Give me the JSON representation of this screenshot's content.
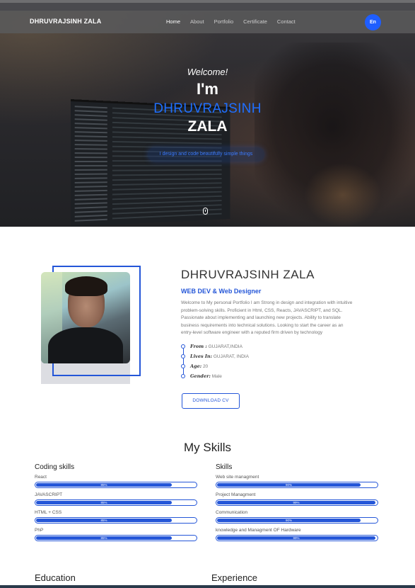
{
  "nav": {
    "brand": "DHRUVRAJSINH ZALA",
    "links": [
      "Home",
      "About",
      "Portfolio",
      "Certificate",
      "Contact"
    ],
    "active": "Home",
    "lang_button": "En"
  },
  "hero": {
    "welcome": "Welcome!",
    "im": "I'm",
    "first_name": "DHRUVRAJSINH",
    "last_name": "ZALA",
    "tagline": "I design and code beautifully simple things"
  },
  "about": {
    "name": "DHRUVRAJSINH ZALA",
    "role": "WEB DEV & Web Designer",
    "description": "Welcome to My personal Portfolio I am Strong in design and integration with intuitive problem-solving skills. Proficient in Html, CSS, Reacts, JAVASCRIPT, and SQL. Passionate about implementing and launching new projects. Ability to translate business requirements into technical solutions. Looking to start the career as an entry-level software engineer with a reputed firm driven by technology",
    "facts": [
      {
        "label": "From :",
        "value": "GUJARAT,INDIA"
      },
      {
        "label": "Lives In:",
        "value": "GUJARAT, INDIA"
      },
      {
        "label": "Age:",
        "value": "20"
      },
      {
        "label": "Gender:",
        "value": "Male"
      }
    ],
    "download_label": "DOWNLOAD CV"
  },
  "skills": {
    "title": "My Skills",
    "coding_title": "Coding skills",
    "coding": [
      {
        "name": "React",
        "percent": 85,
        "label": "85%"
      },
      {
        "name": "JAVASCRIPT",
        "percent": 85,
        "label": "85%"
      },
      {
        "name": "HTML + CSS",
        "percent": 85,
        "label": "85%"
      },
      {
        "name": "PhP",
        "percent": 85,
        "label": "85%"
      }
    ],
    "other_title": "Skills",
    "other": [
      {
        "name": "Web site managment",
        "percent": 90,
        "label": "90%"
      },
      {
        "name": "Project Managment",
        "percent": 99,
        "label": "99%"
      },
      {
        "name": "Communication",
        "percent": 90,
        "label": "90%"
      },
      {
        "name": "knowledge and Managment OF Hardware",
        "percent": 99,
        "label": "99%"
      }
    ]
  },
  "sections": {
    "education": "Education",
    "experience": "Experience"
  },
  "colors": {
    "accent": "#2456d8",
    "nav_bg": "#5a5a5c",
    "lang_button": "#1f5eff"
  },
  "icons": {
    "scroll": "mouse-icon"
  }
}
